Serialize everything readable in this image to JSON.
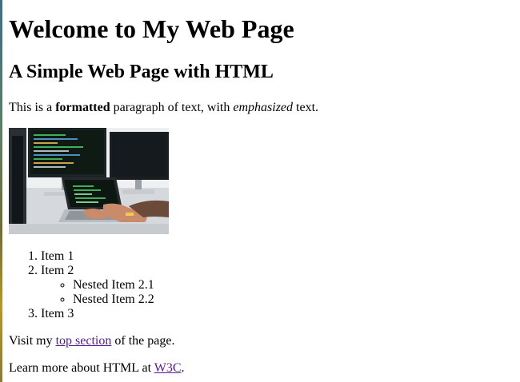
{
  "heading": "Welcome to My Web Page",
  "subheading": "A Simple Web Page with HTML",
  "intro": {
    "before": "This is a ",
    "bold": "formatted",
    "middle": " paragraph of text, with ",
    "italic": "emphasized",
    "after": " text."
  },
  "list": {
    "item1": "Item 1",
    "item2": "Item 2",
    "nested": [
      "Nested Item 2.1",
      "Nested Item 2.2"
    ],
    "item3": "Item 3"
  },
  "visit": {
    "before": "Visit my ",
    "link": "top section",
    "after": " of the page."
  },
  "learn": {
    "before": "Learn more about HTML at ",
    "link": "W3C",
    "after": "."
  },
  "colors": {
    "visited_link": "#551a8b",
    "text": "#000000",
    "background": "#ffffff"
  }
}
